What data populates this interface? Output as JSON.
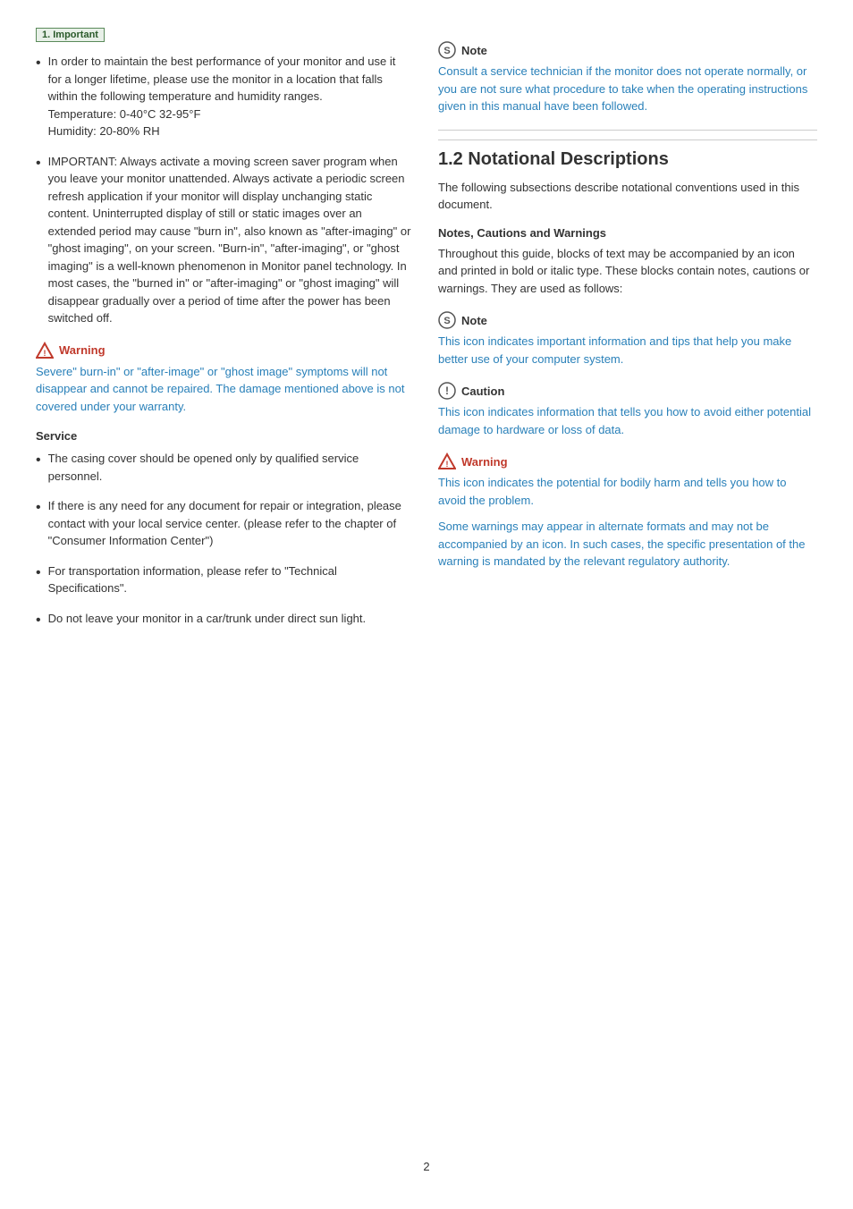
{
  "important_badge": "1. Important",
  "left_col": {
    "bullet1": {
      "text": "In order to maintain the best performance of your monitor and use it for a longer lifetime, please use the monitor in a location that falls within the following temperature and humidity ranges.\nTemperature: 0-40°C 32-95°F\nHumidity: 20-80% RH"
    },
    "bullet2": {
      "text": "IMPORTANT: Always activate a moving screen saver program when you leave your monitor unattended. Always activate a periodic screen refresh application if your monitor will display unchanging static content. Uninterrupted display of still or static images over an extended period may cause \"burn in\", also known as \"after-imaging\" or \"ghost imaging\", on your screen. \"Burn-in\", \"after-imaging\", or \"ghost imaging\" is a well-known phenomenon in Monitor panel technology. In most cases, the \"burned in\" or \"after-imaging\" or \"ghost imaging\" will disappear gradually over a period of time after the power has been switched off."
    },
    "warning": {
      "label": "Warning",
      "text": "Severe\" burn-in\" or \"after-image\" or \"ghost image\" symptoms will not disappear and cannot be repaired. The damage mentioned above is not covered under your warranty."
    },
    "service": {
      "title": "Service",
      "items": [
        "The casing cover should be opened only by qualified service personnel.",
        "If there is any need for any document for repair or integration, please contact with your local service center. (please refer to the chapter of \"Consumer Information Center\")",
        "For transportation information, please refer to \"Technical Specifications\".",
        "Do not leave your monitor in a car/trunk under direct sun light."
      ]
    }
  },
  "right_col": {
    "note_top": {
      "label": "Note",
      "text": "Consult a service technician if the monitor does not operate normally, or you are not sure what procedure to take when the operating instructions given in this manual have been followed."
    },
    "section_heading": "1.2  Notational Descriptions",
    "intro_text": "The following subsections describe notational conventions used in this document.",
    "subheading": "Notes, Cautions and Warnings",
    "subtext": "Throughout this guide, blocks of text may be accompanied by an icon and printed in bold or italic type. These blocks contain notes, cautions or warnings. They are used as follows:",
    "note_block": {
      "label": "Note",
      "text": "This icon indicates important information and tips that help you make better use of your computer system."
    },
    "caution_block": {
      "label": "Caution",
      "text": "This icon indicates information that tells you how to avoid either potential damage to hardware or loss of data."
    },
    "warning_block": {
      "label": "Warning",
      "text1": "This icon indicates the potential for bodily harm and tells you how to avoid the problem.",
      "text2": "Some warnings may appear in alternate formats and may not be accompanied by an icon. In such cases, the specific presentation of the warning is mandated by the relevant regulatory authority."
    }
  },
  "page_number": "2"
}
